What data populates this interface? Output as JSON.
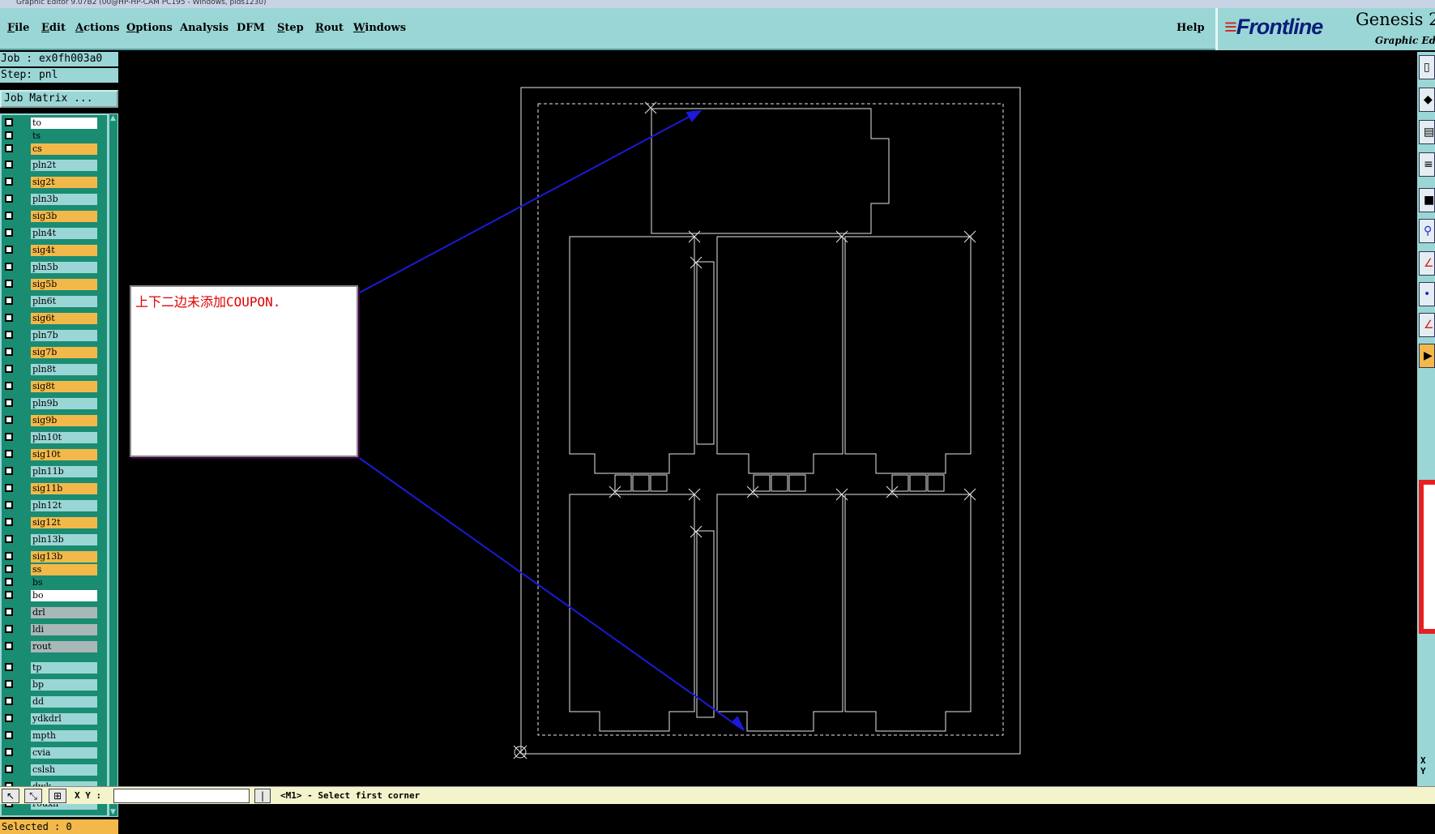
{
  "window": {
    "title": "Graphic Editor 9.07B2 (00@HP-HP-CAM PC195 - Windows, pids1230)"
  },
  "menu": {
    "items": [
      {
        "key": "F",
        "rest": "ile"
      },
      {
        "key": "E",
        "rest": "dit"
      },
      {
        "key": "A",
        "rest": "ctions"
      },
      {
        "key": "O",
        "rest": "ptions"
      },
      {
        "key": "",
        "rest": "Analysis"
      },
      {
        "key": "",
        "rest": "DFM"
      },
      {
        "key": "S",
        "rest": "tep"
      },
      {
        "key": "R",
        "rest": "out"
      },
      {
        "key": "W",
        "rest": "indows"
      }
    ],
    "help": "Help"
  },
  "brand": {
    "logo": "Frontline",
    "product": "Genesis 2",
    "subtitle": "Graphic Edit",
    "logo_color": "#0a1e78",
    "accent_color": "#d02020"
  },
  "job": {
    "label": "Job : ex0fh003a0",
    "step": "Step: pnl"
  },
  "job_matrix_button": "Job Matrix ...",
  "layers": [
    {
      "name": "to",
      "color": "#ffffff"
    },
    {
      "name": "ts",
      "color": "#1a8c72"
    },
    {
      "name": "cs",
      "color": "#f2b94a"
    },
    {
      "name": "pln2t",
      "color": "#9bd6d6"
    },
    {
      "name": "sig2t",
      "color": "#f2b94a"
    },
    {
      "name": "pln3b",
      "color": "#9bd6d6"
    },
    {
      "name": "sig3b",
      "color": "#f2b94a"
    },
    {
      "name": "pln4t",
      "color": "#9bd6d6"
    },
    {
      "name": "sig4t",
      "color": "#f2b94a"
    },
    {
      "name": "pln5b",
      "color": "#9bd6d6"
    },
    {
      "name": "sig5b",
      "color": "#f2b94a"
    },
    {
      "name": "pln6t",
      "color": "#9bd6d6"
    },
    {
      "name": "sig6t",
      "color": "#f2b94a"
    },
    {
      "name": "pln7b",
      "color": "#9bd6d6"
    },
    {
      "name": "sig7b",
      "color": "#f2b94a"
    },
    {
      "name": "pln8t",
      "color": "#9bd6d6"
    },
    {
      "name": "sig8t",
      "color": "#f2b94a"
    },
    {
      "name": "pln9b",
      "color": "#9bd6d6"
    },
    {
      "name": "sig9b",
      "color": "#f2b94a"
    },
    {
      "name": "pln10t",
      "color": "#9bd6d6"
    },
    {
      "name": "sig10t",
      "color": "#f2b94a"
    },
    {
      "name": "pln11b",
      "color": "#9bd6d6"
    },
    {
      "name": "sig11b",
      "color": "#f2b94a"
    },
    {
      "name": "pln12t",
      "color": "#9bd6d6"
    },
    {
      "name": "sig12t",
      "color": "#f2b94a"
    },
    {
      "name": "pln13b",
      "color": "#9bd6d6"
    },
    {
      "name": "sig13b",
      "color": "#f2b94a"
    },
    {
      "name": "ss",
      "color": "#f2b94a"
    },
    {
      "name": "bs",
      "color": "#1a8c72"
    },
    {
      "name": "bo",
      "color": "#ffffff"
    },
    {
      "name": "drl",
      "color": "#a8b8b8"
    },
    {
      "name": "ldi",
      "color": "#a8b8b8"
    },
    {
      "name": "rout",
      "color": "#a8b8b8"
    },
    {
      "name": "tp",
      "color": "#9bd6d6"
    },
    {
      "name": "bp",
      "color": "#9bd6d6"
    },
    {
      "name": "dd",
      "color": "#9bd6d6"
    },
    {
      "name": "ydkdrl",
      "color": "#9bd6d6"
    },
    {
      "name": "mpth",
      "color": "#9bd6d6"
    },
    {
      "name": "cvia",
      "color": "#9bd6d6"
    },
    {
      "name": "cslsh",
      "color": "#9bd6d6"
    },
    {
      "name": "dwk",
      "color": "#9bd6d6"
    },
    {
      "name": "rouxh",
      "color": "#9bd6d6"
    }
  ],
  "selected": "Selected : 0",
  "status": {
    "xy_label": "X Y :",
    "xy_value": "",
    "message": "<M1> - Select first corner"
  },
  "annotation": {
    "text": "上下二边未添加COUPON.",
    "text_color": "#e00000",
    "arrow_color": "#1a1ad8"
  },
  "side": {
    "xy": "X\nY"
  }
}
